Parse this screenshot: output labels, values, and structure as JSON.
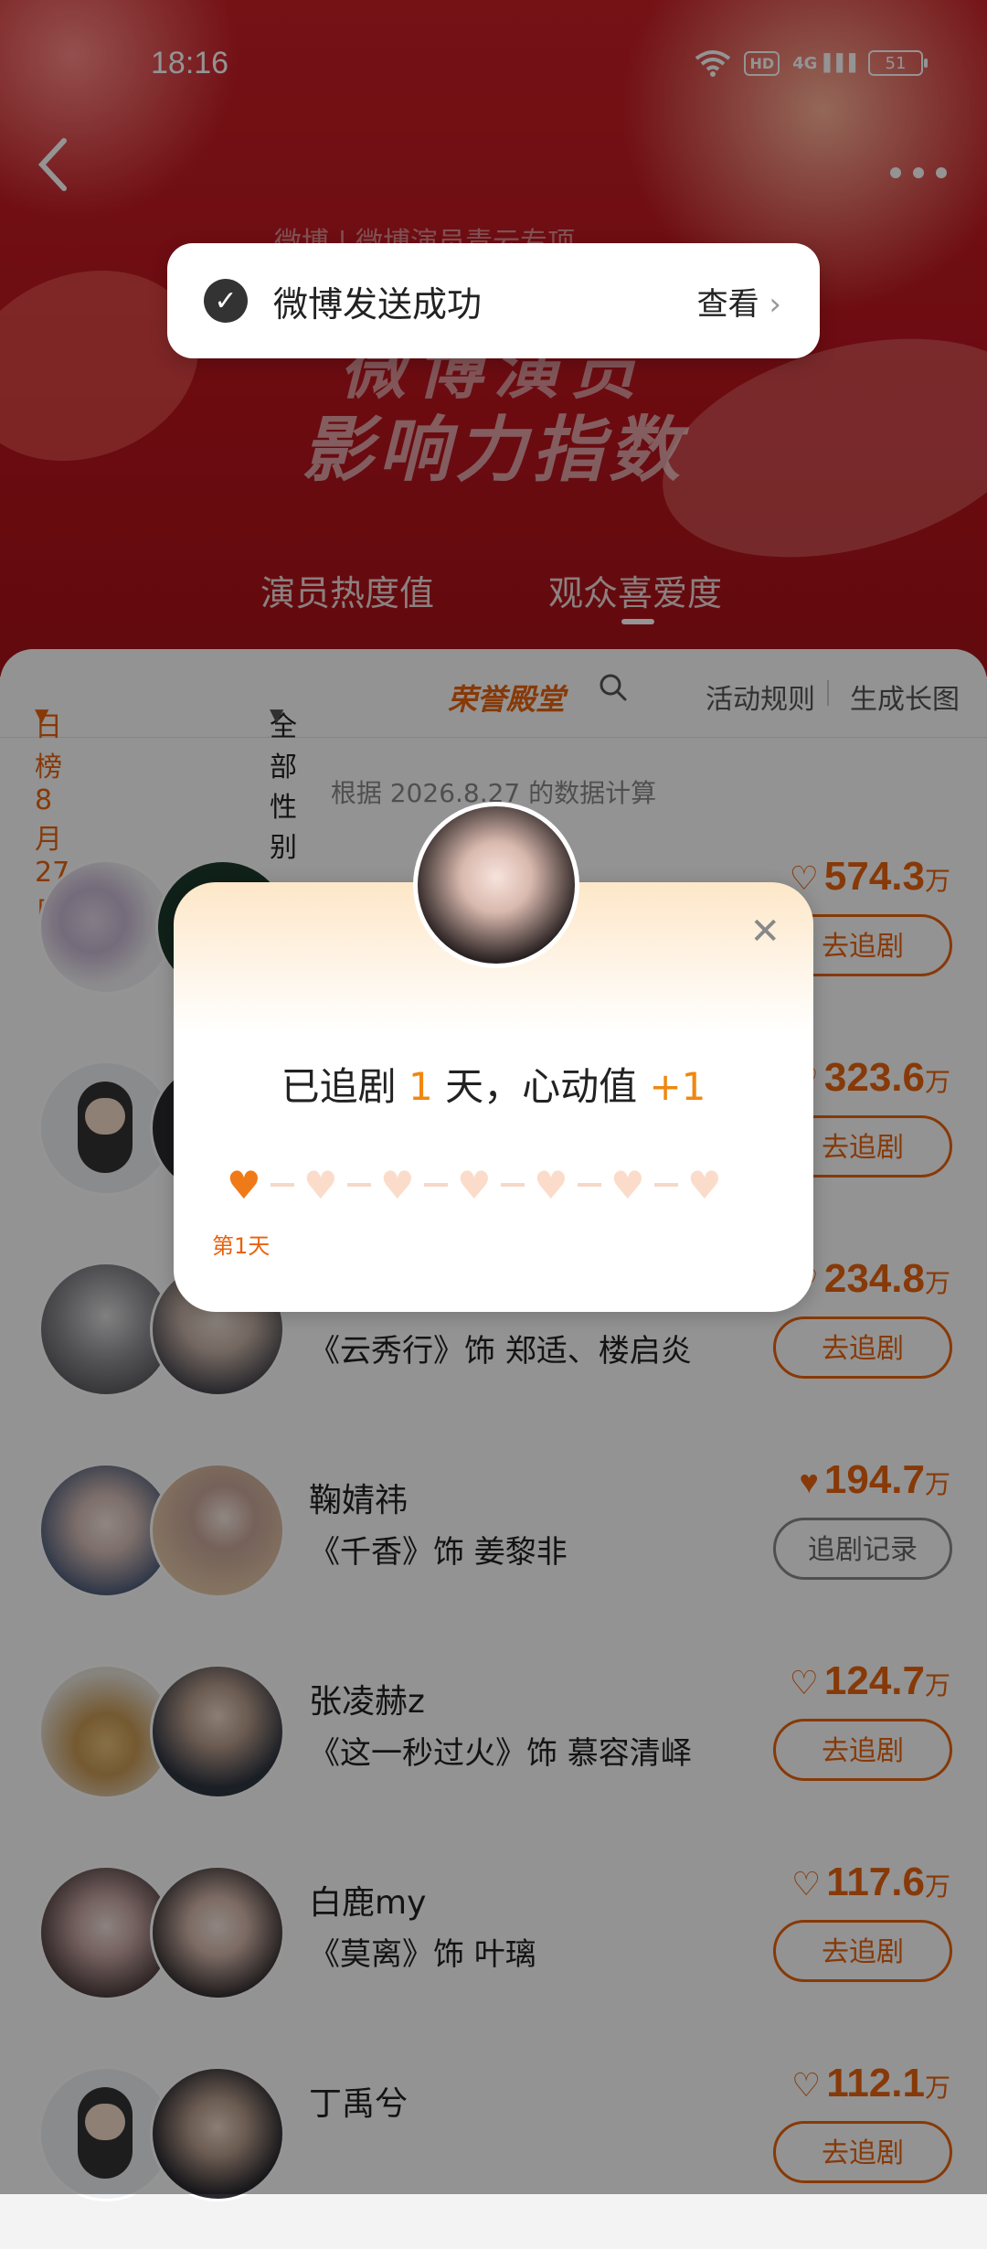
{
  "status_bar": {
    "time": "18:16",
    "network": "4G",
    "hd": "HD",
    "battery": "51",
    "icons": [
      "wifi-icon",
      "hd-icon",
      "signal-icon",
      "battery-icon"
    ]
  },
  "header": {
    "brand_small": "微博 | 微博演员青云专项",
    "brand_title": "微博演员",
    "brand_subtitle": "影响力指数"
  },
  "toast": {
    "text": "微博发送成功",
    "link": "查看"
  },
  "hero_tabs": [
    {
      "label": "演员热度值"
    },
    {
      "label": "观众喜爱度"
    }
  ],
  "filters": {
    "date": "日榜 8月27日",
    "gender": "全部性别",
    "honor": "荣誉殿堂",
    "rules": "活动规则",
    "generate": "生成长图"
  },
  "calc_note": "根据 2026.8.27 的数据计算",
  "rows": [
    {
      "name": "",
      "role": "",
      "score": "574.3",
      "unit": "万",
      "button": "去追剧",
      "liked": false
    },
    {
      "name": "",
      "role": "",
      "score": "323.6",
      "unit": "万",
      "button": "去追剧",
      "liked": false
    },
    {
      "name": "",
      "role": "《云秀行》饰 郑适、楼启炎",
      "score": "234.8",
      "unit": "万",
      "button": "去追剧",
      "liked": false
    },
    {
      "name": "鞠婧祎",
      "role": "《千香》饰 姜黎非",
      "score": "194.7",
      "unit": "万",
      "button": "追剧记录",
      "liked": true
    },
    {
      "name": "张凌赫z",
      "role": "《这一秒过火》饰 慕容清峄",
      "score": "124.7",
      "unit": "万",
      "button": "去追剧",
      "liked": false
    },
    {
      "name": "白鹿my",
      "role": "《莫离》饰 叶璃",
      "score": "117.6",
      "unit": "万",
      "button": "去追剧",
      "liked": false
    },
    {
      "name": "丁禹兮",
      "role": "",
      "score": "112.1",
      "unit": "万",
      "button": "去追剧",
      "liked": false
    }
  ],
  "popup": {
    "text_prefix": "已追剧 ",
    "days": "1",
    "text_middle": " 天，心动值 ",
    "bonus": "+1",
    "day_label": "第1天",
    "streak_total": 7,
    "streak_done": 1
  },
  "colors": {
    "accent": "#e8620f",
    "hero_red": "#c91f27"
  }
}
